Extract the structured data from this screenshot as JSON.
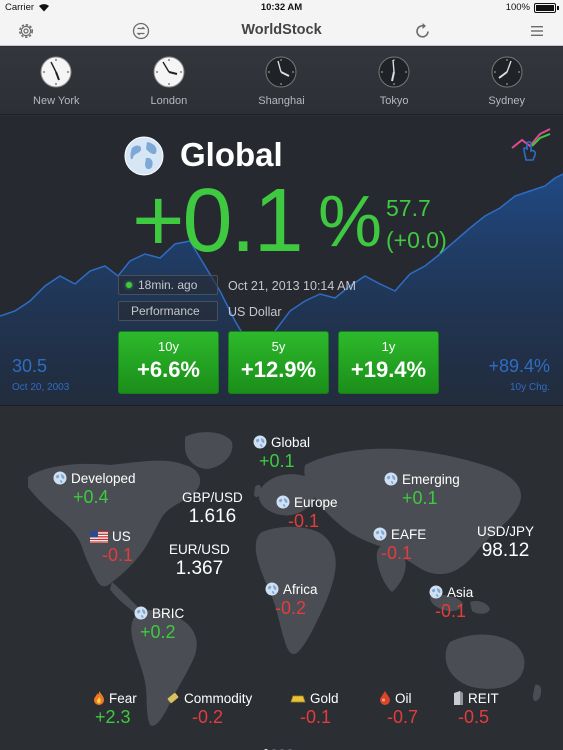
{
  "status_bar": {
    "carrier": "Carrier",
    "time": "10:32 AM",
    "battery": "100%"
  },
  "nav": {
    "title": "WorldStock"
  },
  "clocks": [
    {
      "city": "New York"
    },
    {
      "city": "London"
    },
    {
      "city": "Shanghai"
    },
    {
      "city": "Tokyo"
    },
    {
      "city": "Sydney"
    }
  ],
  "hero": {
    "title": "Global",
    "change_pct": "+0.1",
    "pct_sign": "%",
    "level": "57.7",
    "level_change": "(+0.0)",
    "updated": "18min. ago",
    "timestamp": "Oct 21, 2013 10:14 AM",
    "mode": "Performance",
    "currency": "US Dollar",
    "periods": [
      {
        "label": "10y",
        "value": "+6.6%"
      },
      {
        "label": "5y",
        "value": "+12.9%"
      },
      {
        "label": "1y",
        "value": "+19.4%"
      }
    ],
    "base_value": "30.5",
    "base_date": "Oct 20, 2003",
    "ten_year_change": "+89.4%",
    "ten_year_label": "10y Chg."
  },
  "map": {
    "regions": [
      {
        "name": "Global",
        "value": "+0.1"
      },
      {
        "name": "Developed",
        "value": "+0.4"
      },
      {
        "name": "Emerging",
        "value": "+0.1"
      },
      {
        "name": "US",
        "value": "-0.1"
      },
      {
        "name": "Europe",
        "value": "-0.1"
      },
      {
        "name": "EAFE",
        "value": "-0.1"
      },
      {
        "name": "BRIC",
        "value": "+0.2"
      },
      {
        "name": "Africa",
        "value": "-0.2"
      },
      {
        "name": "Asia",
        "value": "-0.1"
      }
    ],
    "fx": [
      {
        "pair": "GBP/USD",
        "value": "1.616"
      },
      {
        "pair": "EUR/USD",
        "value": "1.367"
      },
      {
        "pair": "USD/JPY",
        "value": "98.12"
      }
    ],
    "commodities": [
      {
        "name": "Fear",
        "value": "+2.3"
      },
      {
        "name": "Commodity",
        "value": "-0.2"
      },
      {
        "name": "Gold",
        "value": "-0.1"
      },
      {
        "name": "Oil",
        "value": "-0.7"
      },
      {
        "name": "REIT",
        "value": "-0.5"
      }
    ]
  },
  "colors": {
    "positive": "#3fc940",
    "negative": "#e23d3d",
    "button_green": "#24a523",
    "baseline_blue": "#2f6cc4"
  },
  "icons": [
    "gear-icon",
    "currency-toggle-icon",
    "refresh-icon",
    "menu-icon",
    "chart-touch-icon",
    "globe-icon",
    "us-flag-icon",
    "fire-icon",
    "commodity-bar-icon",
    "gold-bar-icon",
    "oil-drop-icon",
    "building-icon"
  ]
}
